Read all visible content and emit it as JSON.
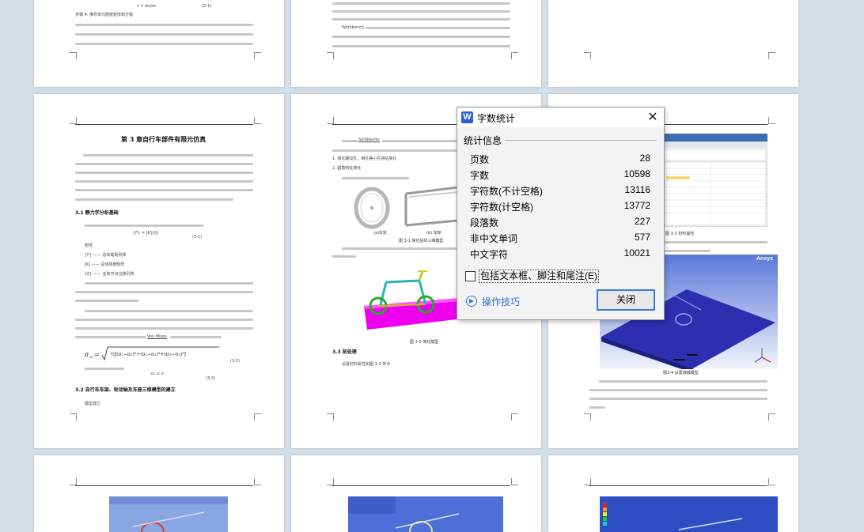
{
  "page_top_left": {
    "formula": "ε = du/dx",
    "formula_no": "(2-1)",
    "step": "步骤 4: 推导单元刚度矩阵和方程"
  },
  "page_top_middle": {
    "brand": "Workbench"
  },
  "chapter_page": {
    "title": "第 3 章自行车部件有限元仿真",
    "section1": "3.1 静力学分析基础",
    "eq1_no": "(3-1)",
    "eq2_no": "(3-2)",
    "eq3_no": "(3-3)",
    "label_matrix": "矩阵",
    "section2": "3.2 自行车车架、轮动轴及车座三维模型的建立",
    "model_text": "模型建立",
    "von_mises": "Von Mises"
  },
  "model_page": {
    "software": "Solidworks",
    "item1": "1. 简化螺纹孔、倒孔等小孔特征简化",
    "item2": "2. 圆角特征简化",
    "caption_a": "(a)车轮",
    "caption_b": "(b) 车架",
    "fig1": "图 3-1 简化后的三维模型",
    "fig2": "图 3-2 简化模型",
    "section3": "3.3 前处理",
    "settings": "设置材料属性如图 3-3 所示"
  },
  "right_page": {
    "fig3": "图 3-3 材料属性",
    "fig4": "图3-4 设置接触模型",
    "ansys": "Ansys"
  },
  "dialog": {
    "title": "字数统计",
    "section": "统计信息",
    "stats": [
      {
        "label": "页数",
        "value": "28"
      },
      {
        "label": "字数",
        "value": "10598"
      },
      {
        "label": "字符数(不计空格)",
        "value": "13116"
      },
      {
        "label": "字符数(计空格)",
        "value": "13772"
      },
      {
        "label": "段落数",
        "value": "227"
      },
      {
        "label": "非中文单词",
        "value": "577"
      },
      {
        "label": "中文字符",
        "value": "10021"
      }
    ],
    "checkbox_label": "包括文本框、脚注和尾注(E)",
    "tips_link": "操作技巧",
    "close_button": "关闭"
  }
}
